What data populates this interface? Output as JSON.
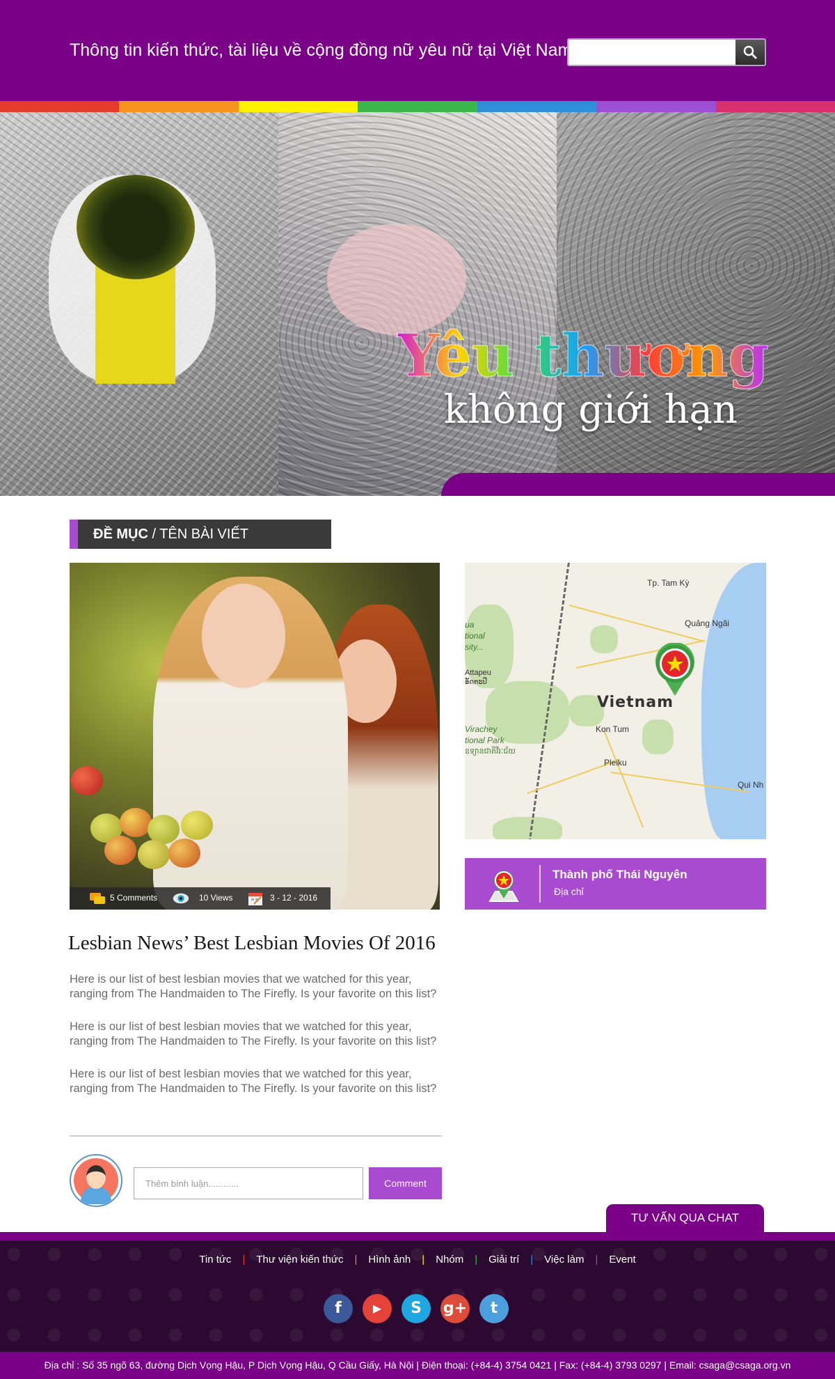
{
  "header": {
    "tagline": "Thông tin kiến thức, tài liệu về cộng đồng nữ yêu nữ tại Việt Nam",
    "search": {
      "value": "",
      "placeholder": "",
      "icon": "search-icon"
    }
  },
  "rainbow_colors": [
    "#e63a2b",
    "#f7941d",
    "#fff200",
    "#3cb54a",
    "#2f8fd8",
    "#9d4fd3",
    "#d6306e"
  ],
  "banner": {
    "title": "Yêu thương",
    "subtitle": "không giới hạn"
  },
  "breadcrumb": {
    "section": "ĐỀ MỤC",
    "separator": " / ",
    "page": "TÊN BÀI VIẾT"
  },
  "article": {
    "stats": {
      "comments": "5 Comments",
      "views": "10 Views",
      "date": "3 - 12 - 2016"
    },
    "title": "Lesbian News’ Best Lesbian Movies Of 2016",
    "paragraphs": [
      "Here is our list of best lesbian movies that we watched for this year, ranging from The Handmaiden to The Firefly. Is your favorite on this list?",
      "Here is our list of best lesbian movies that we watched for this year, ranging from The Handmaiden to The Firefly. Is your favorite on this list?",
      "Here is our list of best lesbian movies that we watched for this year, ranging from The Handmaiden to The Firefly. Is your favorite on this list?"
    ]
  },
  "comment": {
    "placeholder": "Thêm bình luận............",
    "button": "Comment"
  },
  "map": {
    "labels": {
      "tam_ky": "Tp. Tam Kỳ",
      "quang_ngai": "Quảng Ngãi",
      "country": "Vietnam",
      "kon_tum": "Kon Tum",
      "pleiku": "Pleiku",
      "qui_nhon": "Qui Nh",
      "attapeu": "Attapeu",
      "attapeu_local": "ອັດຕະປື",
      "park_1": "Virachey",
      "park_2": "tional Park",
      "park_3": "ឧទ្យានជាតិវីរៈជ័យ",
      "left_1": "ua",
      "left_2": "tional",
      "left_3": "sity..."
    }
  },
  "location": {
    "name": "Thành phố Thái Nguyên",
    "sub": "Địa chỉ"
  },
  "chat_button": "TƯ VẤN QUA CHAT",
  "footer": {
    "nav": [
      "Tin tức",
      "Thư viện kiến thức",
      "Hình ảnh",
      "Nhóm",
      "Giải trí",
      "Việc làm",
      "Event"
    ],
    "separator": "|",
    "separator_colors": [
      "#e63a2b",
      "#f7941d",
      "#fff200",
      "#3cb54a",
      "#2f8fd8",
      "#9d4fd3"
    ],
    "socials": [
      {
        "name": "facebook-icon",
        "glyph": "f",
        "color": "#3b5998"
      },
      {
        "name": "youtube-icon",
        "glyph": "▶",
        "color": "#e5423a"
      },
      {
        "name": "skype-icon",
        "glyph": "S",
        "color": "#1ea7e0"
      },
      {
        "name": "google-plus-icon",
        "glyph": "g+",
        "color": "#dd4b39"
      },
      {
        "name": "twitter-icon",
        "glyph": "t",
        "color": "#4a9fdc"
      }
    ],
    "address": "Địa chỉ : Số 35 ngõ 63, đường Dịch Vọng Hậu, P Dịch Vọng Hậu, Q Cầu Giấy, Hà Nội  |  Điện thoại: (+84-4) 3754 0421  |  Fax: (+84-4) 3793 0297  |  Email: csaga@csaga.org.vn"
  }
}
